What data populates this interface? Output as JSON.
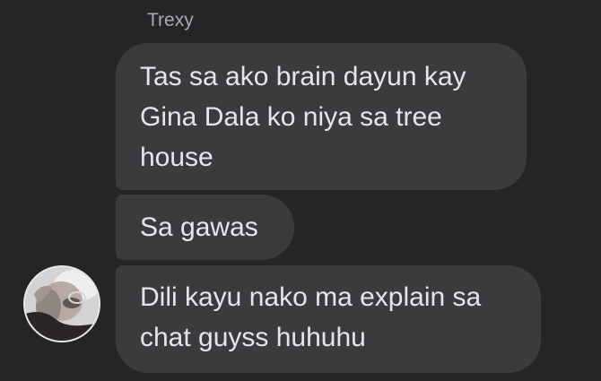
{
  "conversation": {
    "sender_name": "Trexy",
    "messages": [
      {
        "text": "Tas sa ako brain dayun kay Gina Dala ko niya sa tree house"
      },
      {
        "text": "Sa gawas"
      },
      {
        "text": "Dili kayu nako ma explain sa chat guyss huhuhu"
      }
    ],
    "avatar_icon": "user-photo-avatar"
  },
  "colors": {
    "background": "#242526",
    "bubble": "#3a3b3c",
    "message_text": "#e4e6eb",
    "sender_name": "#a8abaf"
  }
}
